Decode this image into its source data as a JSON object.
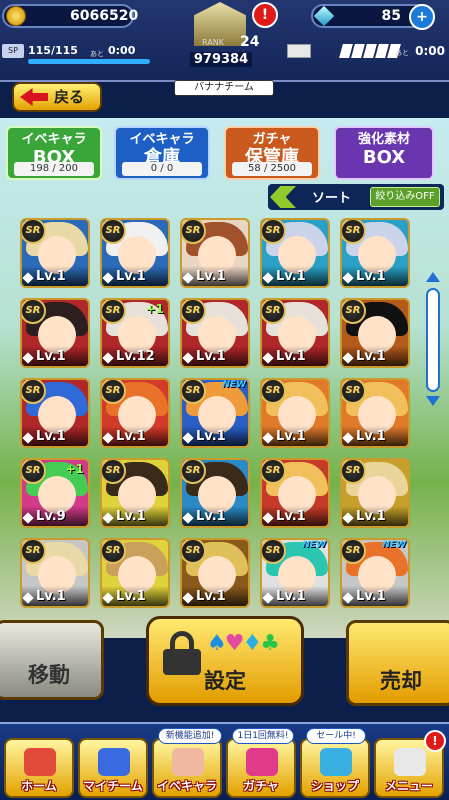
{
  "header": {
    "coins": "6066520",
    "gems": "85",
    "sp_label": "SP",
    "sp_value": "115/115",
    "sp_ato": "あと",
    "sp_timer": "0:00",
    "rank_label": "RANK",
    "rank": "24",
    "score": "979384",
    "energy_ato": "あと",
    "energy_timer": "0:00",
    "alert": "!",
    "team_name": "バナナチーム"
  },
  "back_button": "戻る",
  "tabs": [
    {
      "line1": "イベキャラ",
      "line2": "BOX",
      "count": "198 / 200",
      "color": "#3aa63a"
    },
    {
      "line1": "イベキャラ",
      "line2": "倉庫",
      "count": "0 / 0",
      "color": "#1d5fc4"
    },
    {
      "line1": "ガチャ",
      "line2": "保管庫",
      "count": "58 / 2500",
      "color": "#c9591d"
    },
    {
      "line1": "強化素材",
      "line2": "BOX",
      "count": "",
      "color": "#6a36b0"
    }
  ],
  "sort_label": "ソート",
  "filter_label": "絞り込みOFF",
  "rarity": "SR",
  "cards": [
    {
      "lv": "Lv.1",
      "hair": "#e9d9a6",
      "bg": "#2a6ab8"
    },
    {
      "lv": "Lv.1",
      "hair": "#f0f0f0",
      "bg": "#2a6ab8"
    },
    {
      "lv": "Lv.1",
      "hair": "#a0522d",
      "bg": "#e9d6c2"
    },
    {
      "lv": "Lv.1",
      "hair": "#c9d3ea",
      "bg": "#2aa0c6"
    },
    {
      "lv": "Lv.1",
      "hair": "#c9d3ea",
      "bg": "#2aa0c6"
    },
    {
      "lv": "Lv.1",
      "hair": "#2b1f1f",
      "bg": "#b0282a"
    },
    {
      "lv": "Lv.12",
      "hair": "#e7e1da",
      "bg": "#b0282a",
      "plus": "+1"
    },
    {
      "lv": "Lv.1",
      "hair": "#e7e1da",
      "bg": "#b0282a"
    },
    {
      "lv": "Lv.1",
      "hair": "#e7e1da",
      "bg": "#b0282a"
    },
    {
      "lv": "Lv.1",
      "hair": "#111111",
      "bg": "#b45a1a"
    },
    {
      "lv": "Lv.1",
      "hair": "#2f6ad6",
      "bg": "#b0282a"
    },
    {
      "lv": "Lv.1",
      "hair": "#e8722a",
      "bg": "#d43a2a"
    },
    {
      "lv": "Lv.1",
      "hair": "#ef9b3a",
      "bg": "#2a5fc6",
      "new": "NEW"
    },
    {
      "lv": "Lv.1",
      "hair": "#f2c05a",
      "bg": "#e07a2a"
    },
    {
      "lv": "Lv.1",
      "hair": "#f2c05a",
      "bg": "#e07a2a"
    },
    {
      "lv": "Lv.9",
      "hair": "#44cc55",
      "bg": "#d23a8a",
      "plus": "+1"
    },
    {
      "lv": "Lv.1",
      "hair": "#3a2a1a",
      "bg": "#e0d23a"
    },
    {
      "lv": "Lv.1",
      "hair": "#3a2a1a",
      "bg": "#2a8ac6"
    },
    {
      "lv": "Lv.1",
      "hair": "#f2c05a",
      "bg": "#c63a2a"
    },
    {
      "lv": "Lv.1",
      "hair": "#e9d59a",
      "bg": "#c6a02a"
    },
    {
      "lv": "Lv.1",
      "hair": "#e9d9a6",
      "bg": "#c6c6c6"
    },
    {
      "lv": "Lv.1",
      "hair": "#c9a05a",
      "bg": "#e0d23a"
    },
    {
      "lv": "Lv.1",
      "hair": "#e0c05a",
      "bg": "#8a5a1a"
    },
    {
      "lv": "Lv.1",
      "hair": "#2ac6b0",
      "bg": "#e0e0e0",
      "new": "NEW"
    },
    {
      "lv": "Lv.1",
      "hair": "#e8722a",
      "bg": "#c6c6c6",
      "new": "NEW"
    }
  ],
  "actions": {
    "move": "移動",
    "lock": "設定",
    "sell": "売却"
  },
  "nav": [
    {
      "label": "ホーム",
      "tag": ""
    },
    {
      "label": "マイチーム",
      "tag": ""
    },
    {
      "label": "イベキャラ",
      "tag": "新機能追加!"
    },
    {
      "label": "ガチャ",
      "tag": "1日1回無料!"
    },
    {
      "label": "ショップ",
      "tag": "セール中!"
    },
    {
      "label": "メニュー",
      "tag": ""
    }
  ]
}
